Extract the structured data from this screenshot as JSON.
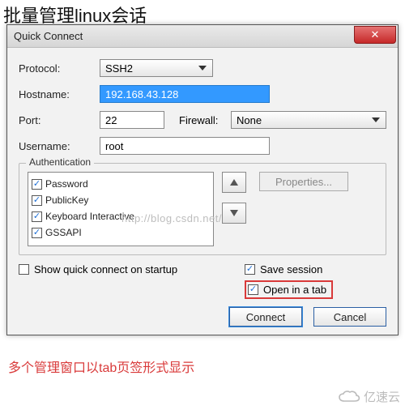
{
  "page_heading": "批量管理linux会话",
  "dialog": {
    "title": "Quick Connect",
    "fields": {
      "protocol_label": "Protocol:",
      "protocol_value": "SSH2",
      "hostname_label": "Hostname:",
      "hostname_value": "192.168.43.128",
      "port_label": "Port:",
      "port_value": "22",
      "firewall_label": "Firewall:",
      "firewall_value": "None",
      "username_label": "Username:",
      "username_value": "root"
    },
    "auth": {
      "legend": "Authentication",
      "items": [
        {
          "label": "Password",
          "checked": true
        },
        {
          "label": "PublicKey",
          "checked": true
        },
        {
          "label": "Keyboard Interactive",
          "checked": true
        },
        {
          "label": "GSSAPI",
          "checked": true
        }
      ],
      "properties_btn": "Properties..."
    },
    "options": {
      "show_on_startup": "Show quick connect on startup",
      "show_on_startup_checked": false,
      "save_session": "Save session",
      "save_session_checked": true,
      "open_in_tab": "Open in a tab",
      "open_in_tab_checked": true
    },
    "buttons": {
      "connect": "Connect",
      "cancel": "Cancel"
    }
  },
  "watermark": "http://blog.csdn.net/",
  "annotation": "多个管理窗口以tab页签形式显示",
  "logo": "亿速云"
}
